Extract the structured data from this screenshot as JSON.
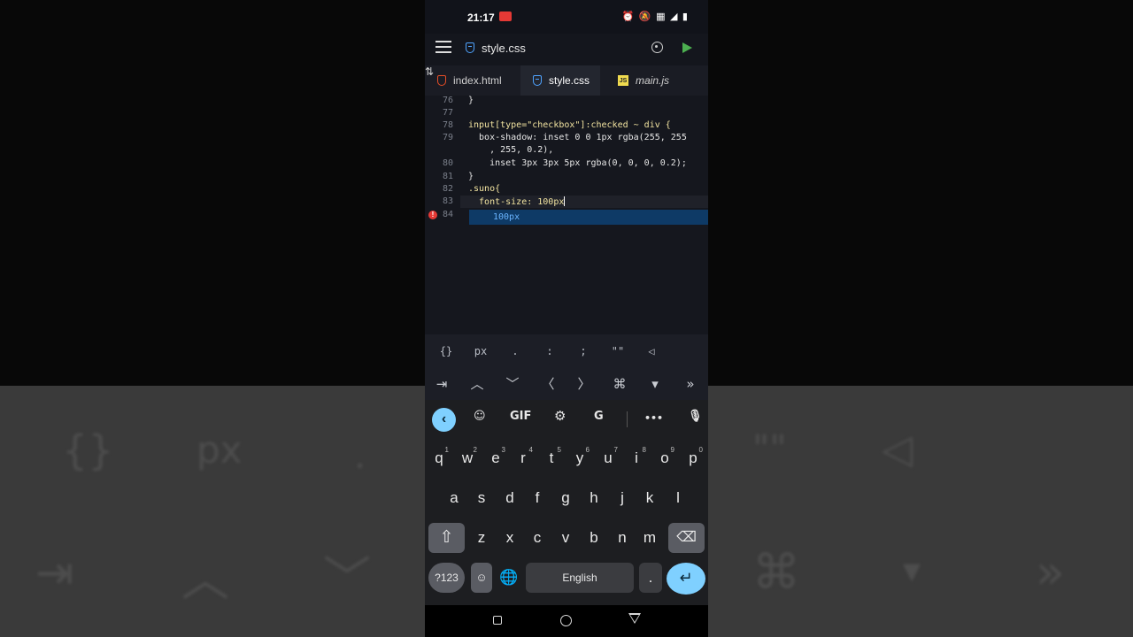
{
  "status": {
    "time": "21:17",
    "icons": "⏰ 🔕 ▦ ◢ ▮"
  },
  "appbar": {
    "title": "style.css"
  },
  "tabs": [
    {
      "label": "index.html",
      "icon": "html-file-icon"
    },
    {
      "label": "style.css",
      "icon": "css-file-icon",
      "active": true
    },
    {
      "label": "main.js",
      "icon": "js-file-icon"
    }
  ],
  "editor": {
    "lines": [
      {
        "n": "76",
        "text": "}"
      },
      {
        "n": "77",
        "text": ""
      },
      {
        "n": "78",
        "text": "input[type=\"checkbox\"]:checked ~ div {"
      },
      {
        "n": "79",
        "text": "  box-shadow: inset 0 0 1px rgba(255, 255"
      },
      {
        "n": "",
        "text": "    , 255, 0.2),"
      },
      {
        "n": "80",
        "text": "    inset 3px 3px 5px rgba(0, 0, 0, 0.2);"
      },
      {
        "n": "81",
        "text": "}"
      },
      {
        "n": "82",
        "text": ".suno{"
      },
      {
        "n": "83",
        "text": "  font-size: 100px"
      },
      {
        "n": "84",
        "text": "}"
      }
    ],
    "suggestion": "100px",
    "error_marker": "!"
  },
  "accessory_row1": [
    "{}",
    "px",
    ".",
    ":",
    ";",
    "\"\"",
    "◁"
  ],
  "accessory_row2": [
    "⇥",
    "︿",
    "﹀",
    "〈",
    "〉",
    "⌘",
    "▾",
    "»"
  ],
  "keyboard": {
    "toolbar": {
      "gif": "GIF",
      "more": "•••"
    },
    "row1": [
      {
        "k": "q",
        "s": "1"
      },
      {
        "k": "w",
        "s": "2"
      },
      {
        "k": "e",
        "s": "3"
      },
      {
        "k": "r",
        "s": "4"
      },
      {
        "k": "t",
        "s": "5"
      },
      {
        "k": "y",
        "s": "6"
      },
      {
        "k": "u",
        "s": "7"
      },
      {
        "k": "i",
        "s": "8"
      },
      {
        "k": "o",
        "s": "9"
      },
      {
        "k": "p",
        "s": "0"
      }
    ],
    "row2": [
      "a",
      "s",
      "d",
      "f",
      "g",
      "h",
      "j",
      "k",
      "l"
    ],
    "row3": [
      "z",
      "x",
      "c",
      "v",
      "b",
      "n",
      "m"
    ],
    "symbols_label": "?123",
    "emoji_label": "☺",
    "space_label": "English",
    "period_label": "."
  },
  "colors": {
    "accent": "#7fd0ff",
    "run": "#4caf50",
    "error": "#e53935"
  }
}
